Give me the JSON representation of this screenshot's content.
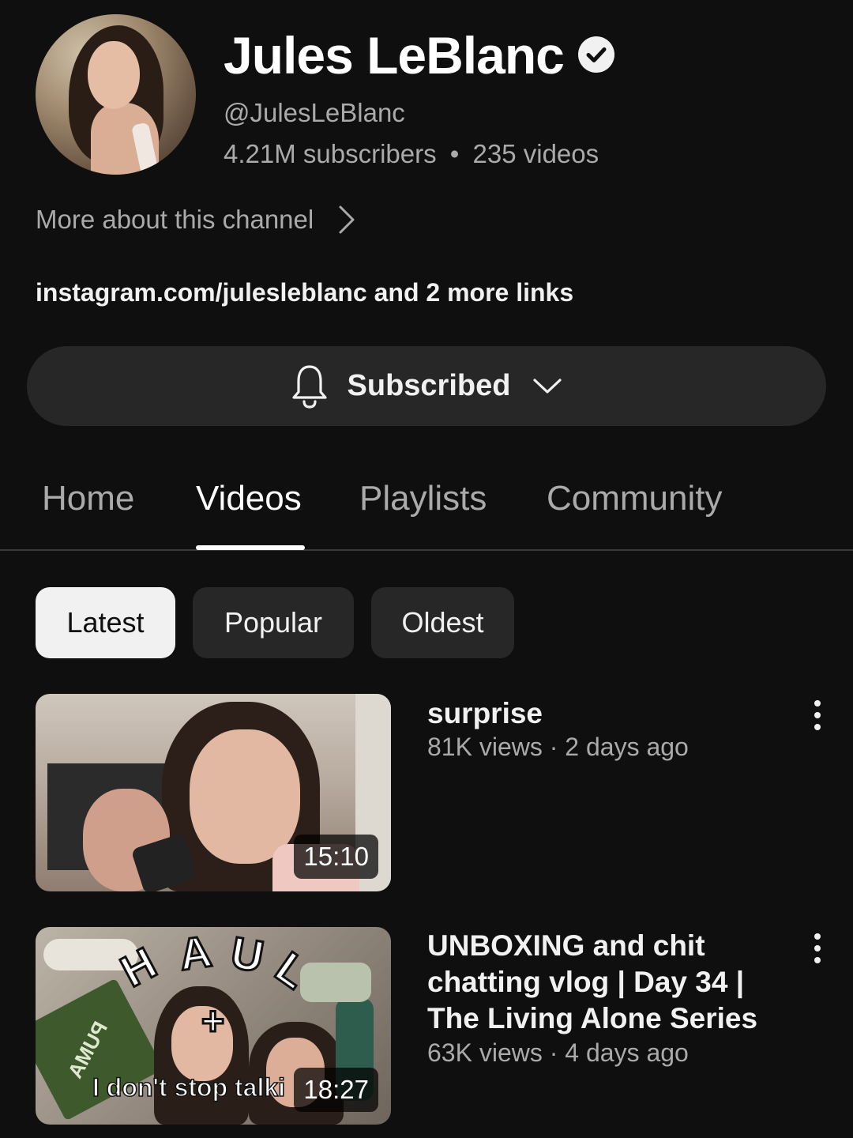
{
  "channel": {
    "name": "Jules LeBlanc",
    "handle": "@JulesLeBlanc",
    "subscribers": "4.21M subscribers",
    "separator": "•",
    "videos": "235 videos",
    "more_about": "More about this channel",
    "links": "instagram.com/julesleblanc and 2 more links"
  },
  "subscribe_button": {
    "label": "Subscribed",
    "icon": "bell-icon"
  },
  "tabs": [
    {
      "label": "Home",
      "active": false
    },
    {
      "label": "Videos",
      "active": true
    },
    {
      "label": "Playlists",
      "active": false
    },
    {
      "label": "Community",
      "active": false
    }
  ],
  "filters": [
    {
      "label": "Latest",
      "active": true
    },
    {
      "label": "Popular",
      "active": false
    },
    {
      "label": "Oldest",
      "active": false
    }
  ],
  "videos": [
    {
      "title": "surprise",
      "meta": "81K views · 2 days ago",
      "duration": "15:10"
    },
    {
      "title": "UNBOXING and chit chatting vlog | Day 34 | The Living Alone Series",
      "meta": "63K views · 4 days ago",
      "duration": "18:27",
      "thumbnail_text": {
        "haul": "HAUL",
        "plus": "+",
        "caption": "I don't stop talki",
        "box": "PUMA"
      }
    }
  ],
  "colors": {
    "background": "#0f0f0f",
    "surface": "#272727",
    "text_primary": "#f1f1f1",
    "text_secondary": "#aaaaaa"
  }
}
